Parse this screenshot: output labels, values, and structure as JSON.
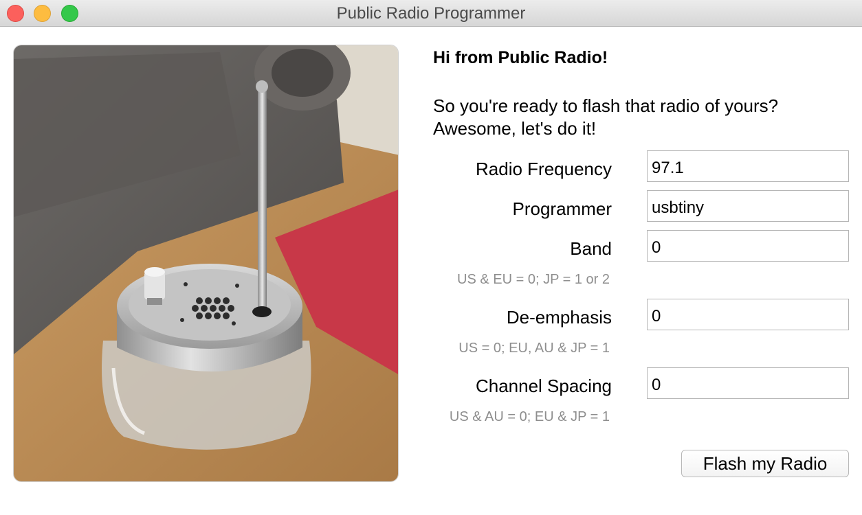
{
  "window": {
    "title": "Public Radio Programmer"
  },
  "photo": {
    "description_icon": "radio-jar-photo"
  },
  "content": {
    "greeting": "Hi from Public Radio!",
    "intro_line1": "So you're ready to flash that radio of yours?",
    "intro_line2": "Awesome, let's do it!"
  },
  "form": {
    "frequency": {
      "label": "Radio Frequency",
      "value": "97.1"
    },
    "programmer": {
      "label": "Programmer",
      "value": "usbtiny"
    },
    "band": {
      "label": "Band",
      "value": "0",
      "hint": "US & EU = 0; JP = 1 or 2"
    },
    "deemphasis": {
      "label": "De-emphasis",
      "value": "0",
      "hint": "US = 0; EU, AU & JP = 1"
    },
    "spacing": {
      "label": "Channel Spacing",
      "value": "0",
      "hint": "US & AU = 0; EU & JP = 1"
    },
    "submit_label": "Flash my Radio"
  },
  "colors": {
    "close": "#fc605c",
    "minimize": "#fdbc40",
    "maximize": "#34c84a"
  }
}
